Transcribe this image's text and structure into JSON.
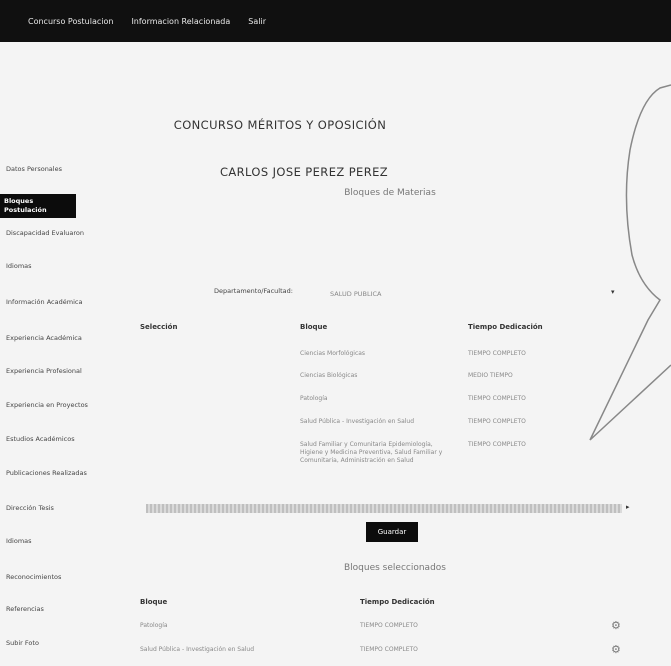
{
  "topnav": {
    "items": [
      "Concurso Postulacion",
      "Informacion Relacionada",
      "Salir"
    ]
  },
  "page": {
    "title": "CONCURSO MÉRITOS Y OPOSICIÓN",
    "applicant": "CARLOS JOSE PEREZ PEREZ"
  },
  "sidebar": {
    "items": [
      {
        "label": "Datos Personales"
      },
      {
        "label": "Bloques Postulación"
      },
      {
        "label": "Discapacidad Evaluaron"
      },
      {
        "label": "Idiomas"
      },
      {
        "label": "Información Académica"
      },
      {
        "label": "Experiencia Académica"
      },
      {
        "label": "Experiencia Profesional"
      },
      {
        "label": "Experiencia en Proyectos"
      },
      {
        "label": "Estudios Académicos"
      },
      {
        "label": "Publicaciones Realizadas"
      },
      {
        "label": "Dirección Tesis"
      },
      {
        "label": "Idiomas"
      },
      {
        "label": "Reconocimientos"
      },
      {
        "label": "Referencias"
      },
      {
        "label": "Subir Foto"
      }
    ]
  },
  "section1": {
    "title": "Bloques de Materias",
    "dept_label": "Departamento/Facultad:",
    "dept_value": "SALUD PUBLICA",
    "headers": {
      "select": "Selección",
      "block": "Bloque",
      "time": "Tiempo Dedicación"
    },
    "rows": [
      {
        "block": "Ciencias Morfológicas",
        "time": "TIEMPO COMPLETO"
      },
      {
        "block": "Ciencias Biológicas",
        "time": "MEDIO TIEMPO"
      },
      {
        "block": "Patología",
        "time": "TIEMPO COMPLETO"
      },
      {
        "block": "Salud Pública - Investigación en Salud",
        "time": "TIEMPO COMPLETO"
      },
      {
        "block": "Salud Familiar y Comunitaria Epidemiología, Higiene y Medicina Preventiva, Salud Familiar y Comunitaria, Administración en Salud",
        "time": "TIEMPO COMPLETO"
      }
    ]
  },
  "buttons": {
    "save": "Guardar"
  },
  "section2": {
    "title": "Bloques seleccionados",
    "headers": {
      "block": "Bloque",
      "time": "Tiempo Dedicación"
    },
    "rows": [
      {
        "block": "Patología",
        "time": "TIEMPO COMPLETO"
      },
      {
        "block": "Salud Pública - Investigación en Salud",
        "time": "TIEMPO COMPLETO"
      }
    ]
  },
  "icons": {
    "row_action": "gear-icon",
    "dropdown": "caret-down-icon",
    "scroll": "arrow-right-icon"
  },
  "colors": {
    "topbar": "#101010",
    "active_nav": "#0c0c0c",
    "button": "#0c0c0c"
  }
}
